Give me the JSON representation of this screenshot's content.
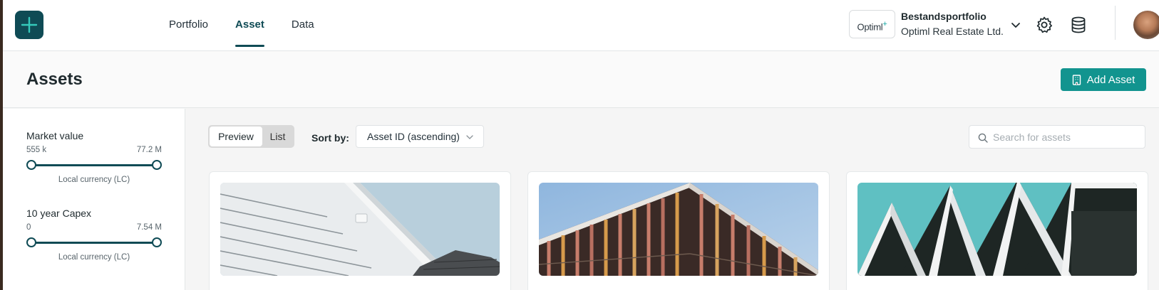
{
  "nav": {
    "tabs": [
      {
        "label": "Portfolio",
        "active": false
      },
      {
        "label": "Asset",
        "active": true
      },
      {
        "label": "Data",
        "active": false
      }
    ]
  },
  "org": {
    "logo_text": "Optiml",
    "logo_mark": "+",
    "portfolio_name": "Bestandsportfolio",
    "company": "Optiml Real Estate Ltd."
  },
  "header_icons": [
    "chevron-down-icon",
    "gear-icon",
    "database-icon"
  ],
  "page": {
    "title": "Assets",
    "add_button_label": "Add Asset"
  },
  "filters": [
    {
      "title": "Market value",
      "min": "555 k",
      "max": "77.2 M",
      "unit": "Local currency (LC)"
    },
    {
      "title": "10 year Capex",
      "min": "0",
      "max": "7.54 M",
      "unit": "Local currency (LC)"
    }
  ],
  "view_toggle": {
    "options": [
      "Preview",
      "List"
    ],
    "selected": "Preview"
  },
  "sort": {
    "label": "Sort by:",
    "value": "Asset ID (ascending)"
  },
  "search": {
    "placeholder": "Search for assets",
    "value": ""
  },
  "colors": {
    "brand": "#0f4b55",
    "accent": "#12948f"
  }
}
